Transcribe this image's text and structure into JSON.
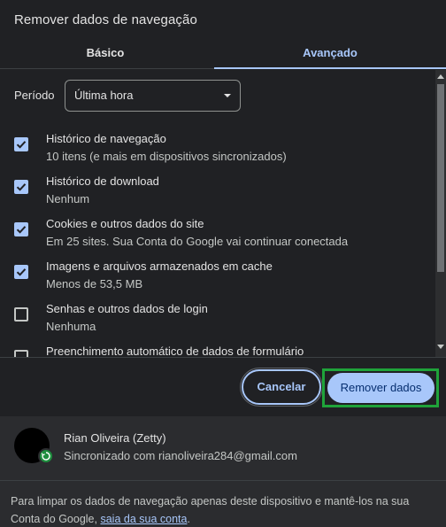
{
  "dialog": {
    "title": "Remover dados de navegação",
    "tabs": [
      {
        "label": "Básico",
        "active": false
      },
      {
        "label": "Avançado",
        "active": true
      }
    ]
  },
  "period": {
    "label": "Período",
    "selected": "Última hora"
  },
  "options": [
    {
      "title": "Histórico de navegação",
      "subtitle": "10 itens (e mais em dispositivos sincronizados)",
      "checked": true
    },
    {
      "title": "Histórico de download",
      "subtitle": "Nenhum",
      "checked": true
    },
    {
      "title": "Cookies e outros dados do site",
      "subtitle": "Em 25 sites. Sua Conta do Google vai continuar conectada",
      "checked": true
    },
    {
      "title": "Imagens e arquivos armazenados em cache",
      "subtitle": "Menos de 53,5 MB",
      "checked": true
    },
    {
      "title": "Senhas e outros dados de login",
      "subtitle": "Nenhuma",
      "checked": false
    },
    {
      "title": "Preenchimento automático de dados de formulário",
      "subtitle": "",
      "checked": false
    }
  ],
  "buttons": {
    "cancel": "Cancelar",
    "remove": "Remover dados"
  },
  "account": {
    "name": "Rian Oliveira (Zetty)",
    "sync_status": "Sincronizado com rianoliveira284@gmail.com"
  },
  "footer_note": {
    "text": "Para limpar os dados de navegação apenas deste dispositivo e mantê-los na sua Conta do Google, ",
    "link": "saia da sua conta",
    "end": "."
  },
  "colors": {
    "background": "#202124",
    "accent": "#a8c7fa",
    "highlight_border": "#1fa33a"
  }
}
